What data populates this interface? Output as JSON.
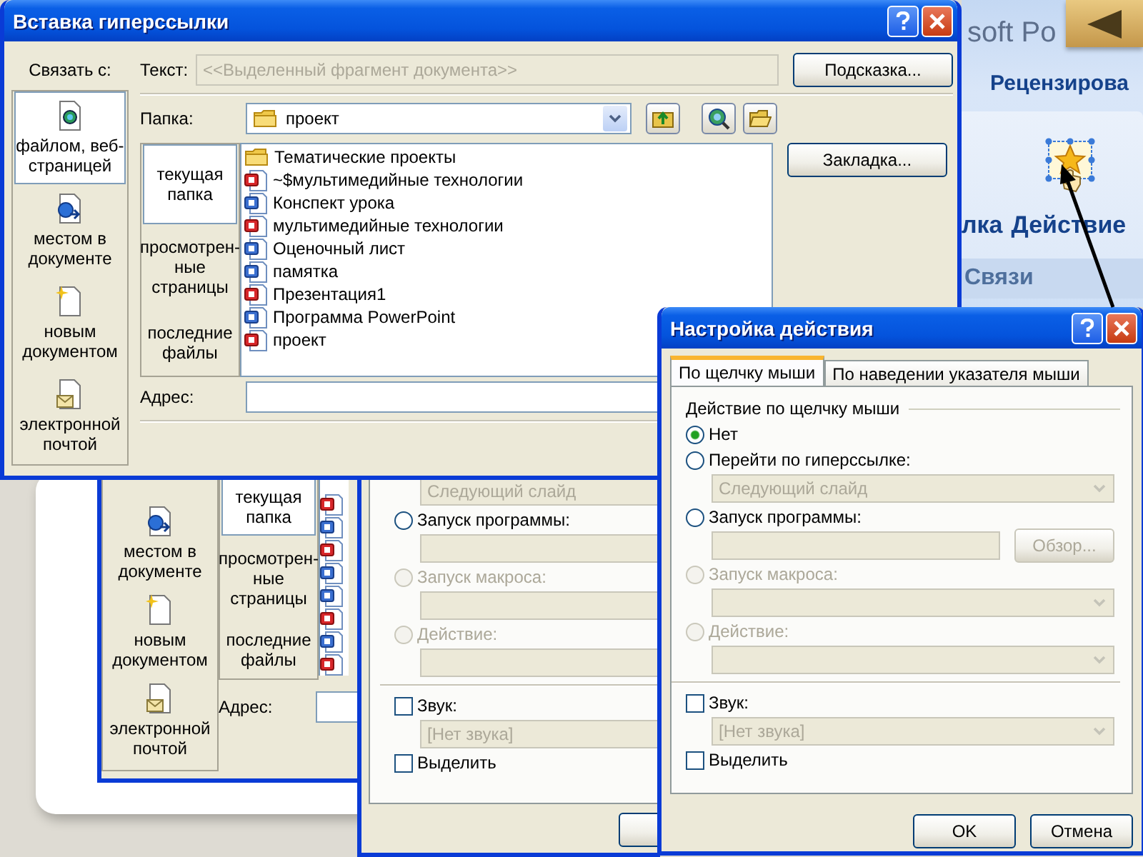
{
  "ribbon": {
    "title_fragment": "soft Po",
    "tab": "Рецензирова",
    "labels": [
      "лка",
      "Действие"
    ],
    "group": "Связи"
  },
  "hyperlink_dialog": {
    "title": "Вставка гиперссылки",
    "link_label": "Связать с:",
    "link_targets": [
      {
        "kind": "file",
        "label": "файлом, веб-\nстраницей",
        "selected": true
      },
      {
        "kind": "place",
        "label": "местом в\nдокументе",
        "selected": false
      },
      {
        "kind": "new",
        "label": "новым\nдокументом",
        "selected": false
      },
      {
        "kind": "email",
        "label": "электронной\nпочтой",
        "selected": false
      }
    ],
    "text_label": "Текст:",
    "text_field": {
      "value": "<<Выделенный фрагмент документа>>",
      "disabled": true
    },
    "tip_button": "Подсказка...",
    "folder_label": "Папка:",
    "folder": "проект",
    "views": [
      {
        "label": "текущая\nпапка",
        "selected": true
      },
      {
        "label": "просмотрен-\nные\nстраницы",
        "selected": false
      },
      {
        "label": "последние\nфайлы",
        "selected": false
      }
    ],
    "files": [
      {
        "kind": "folder",
        "name": "Тематические проекты"
      },
      {
        "kind": "presentation",
        "name": "~$мультимедийные технологии"
      },
      {
        "kind": "document",
        "name": "Конспект урока"
      },
      {
        "kind": "presentation",
        "name": "мультимедийные технологии"
      },
      {
        "kind": "document",
        "name": "Оценочный лист"
      },
      {
        "kind": "document",
        "name": "памятка"
      },
      {
        "kind": "presentation",
        "name": "Презентация1"
      },
      {
        "kind": "document",
        "name": "Программа PowerPoint"
      },
      {
        "kind": "presentation",
        "name": "проект"
      }
    ],
    "bookmark_button": "Закладка...",
    "address_label": "Адрес:"
  },
  "back_hyperlink_dialog": {
    "link_targets": [
      {
        "kind": "place",
        "label": "местом в\nдокументе",
        "selected": false
      },
      {
        "kind": "new",
        "label": "новым\nдокументом",
        "selected": false
      },
      {
        "kind": "email",
        "label": "электронной\nпочтой",
        "selected": false
      }
    ],
    "views": [
      {
        "label": "текущая\nпапка",
        "selected": true
      },
      {
        "label": "просмотрен-\nные\nстраницы",
        "selected": false
      },
      {
        "label": "последние\nфайлы",
        "selected": false
      }
    ],
    "files": [
      {
        "kind": "presentation"
      },
      {
        "kind": "document"
      },
      {
        "kind": "presentation"
      },
      {
        "kind": "document"
      },
      {
        "kind": "document"
      },
      {
        "kind": "presentation"
      },
      {
        "kind": "document"
      },
      {
        "kind": "presentation"
      }
    ],
    "address_label": "Адрес:"
  },
  "back_action_dialog": {
    "options": [
      {
        "kind": "select",
        "value": "Следующий слайд",
        "disabled": true
      },
      {
        "kind": "radio",
        "label": "Запуск программы:",
        "selected": false,
        "disabled": false
      },
      {
        "kind": "select",
        "disabled": true
      },
      {
        "kind": "radio",
        "label": "Запуск макроса:",
        "selected": false,
        "disabled": true
      },
      {
        "kind": "select",
        "disabled": true
      },
      {
        "kind": "radio",
        "label": "Действие:",
        "selected": false,
        "disabled": true
      },
      {
        "kind": "select",
        "disabled": true
      }
    ],
    "sound": {
      "label": "Звук:",
      "checked": false
    },
    "sound_select": {
      "value": "[Нет звука]",
      "disabled": true
    },
    "highlight": {
      "label": "Выделить",
      "checked": false
    }
  },
  "action_dialog": {
    "title": "Настройка действия",
    "tabs": [
      {
        "label": "По щелчку мыши",
        "selected": true
      },
      {
        "label": "По наведении указателя мыши",
        "selected": false
      }
    ],
    "group_label": "Действие по щелчку мыши",
    "options": [
      {
        "kind": "radio",
        "label": "Нет",
        "selected": true,
        "disabled": false
      },
      {
        "kind": "radio",
        "label": "Перейти по гиперссылке:",
        "selected": false,
        "disabled": false
      },
      {
        "kind": "select",
        "value": "Следующий слайд",
        "disabled": true
      },
      {
        "kind": "radio",
        "label": "Запуск программы:",
        "selected": false,
        "disabled": false
      },
      {
        "kind": "browse",
        "button": "Обзор...",
        "disabled": true
      },
      {
        "kind": "radio",
        "label": "Запуск макроса:",
        "selected": false,
        "disabled": true
      },
      {
        "kind": "select",
        "disabled": true
      },
      {
        "kind": "radio",
        "label": "Действие:",
        "selected": false,
        "disabled": true
      },
      {
        "kind": "select",
        "disabled": true
      }
    ],
    "sound": {
      "label": "Звук:",
      "checked": false
    },
    "sound_select": {
      "value": "[Нет звука]",
      "disabled": true
    },
    "highlight": {
      "label": "Выделить",
      "checked": false
    },
    "buttons": [
      "OK",
      "Отмена"
    ]
  }
}
